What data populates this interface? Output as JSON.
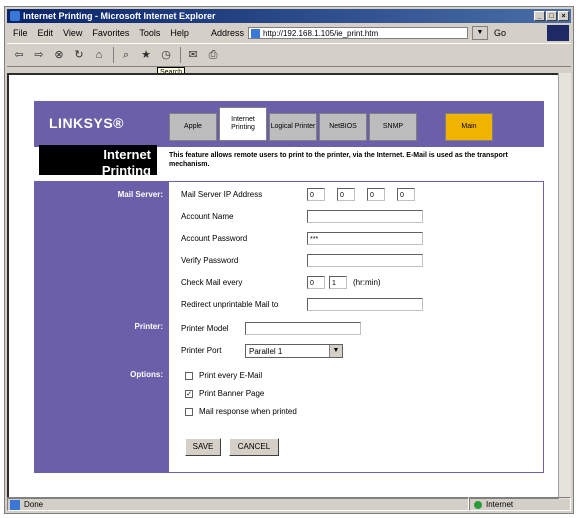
{
  "window": {
    "title": "Internet Printing - Microsoft Internet Explorer",
    "controls": [
      "_",
      "□",
      "×"
    ]
  },
  "menu": {
    "items": [
      "File",
      "Edit",
      "View",
      "Favorites",
      "Tools",
      "Help"
    ],
    "address_label": "Address",
    "address_value": "http://192.168.1.105/ie_print.htm",
    "go_label": "Go"
  },
  "toolbar": {
    "tooltip": "Search"
  },
  "brand": {
    "logo": "LINKSYS®"
  },
  "tabs": [
    {
      "label": "Apple"
    },
    {
      "label": "Internet Printing"
    },
    {
      "label": "Logical Printer"
    },
    {
      "label": "NetBIOS"
    },
    {
      "label": "SNMP"
    },
    {
      "label": "Main"
    }
  ],
  "page": {
    "title_line1": "Internet",
    "title_line2": "Printing",
    "description": "This feature allows remote users to print to the printer, via the Internet. E-Mail is used as the transport mechanism."
  },
  "mail_server": {
    "section": "Mail Server:",
    "ip_label": "Mail Server IP Address",
    "ip": [
      "0",
      "0",
      "0",
      "0"
    ],
    "account_name_label": "Account Name",
    "account_password_label": "Account Password",
    "account_password_value": "***",
    "verify_password_label": "Verify Password",
    "check_mail_label": "Check Mail every",
    "check_mail_hours": "0",
    "check_mail_minutes": "1",
    "check_mail_unit": "(hr:min)",
    "redirect_label": "Redirect unprintable Mail to"
  },
  "printer": {
    "section": "Printer:",
    "model_label": "Printer Model",
    "port_label": "Printer Port",
    "port_value": "Parallel 1"
  },
  "options": {
    "section": "Options:",
    "items": [
      {
        "label": "Print every E-Mail",
        "checked": false
      },
      {
        "label": "Print Banner Page",
        "checked": true
      },
      {
        "label": "Mail response when printed",
        "checked": false
      }
    ]
  },
  "buttons": {
    "save": "SAVE",
    "cancel": "CANCEL"
  },
  "status": {
    "left": "Done",
    "zone": "Internet"
  }
}
